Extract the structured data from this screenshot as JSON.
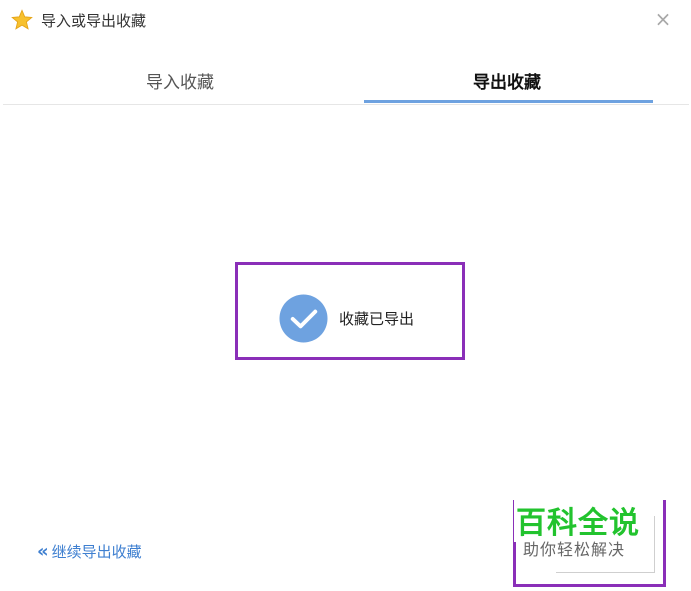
{
  "window": {
    "title": "导入或导出收藏",
    "title_icon": "star-icon",
    "close_label": "×"
  },
  "tabs": [
    {
      "label": "导入收藏",
      "active": false
    },
    {
      "label": "导出收藏",
      "active": true
    }
  ],
  "status": {
    "icon": "check-circle-icon",
    "message": "收藏已导出"
  },
  "footer": {
    "continue_chevron": "«",
    "continue_label": "继续导出收藏"
  },
  "watermark": {
    "title": "百科全说",
    "subtitle": "助你轻松解决"
  },
  "colors": {
    "accent": "#6ea2e0",
    "link": "#3e7fd0",
    "highlight_border": "#8a2fb8",
    "watermark_green": "#22c32e"
  }
}
